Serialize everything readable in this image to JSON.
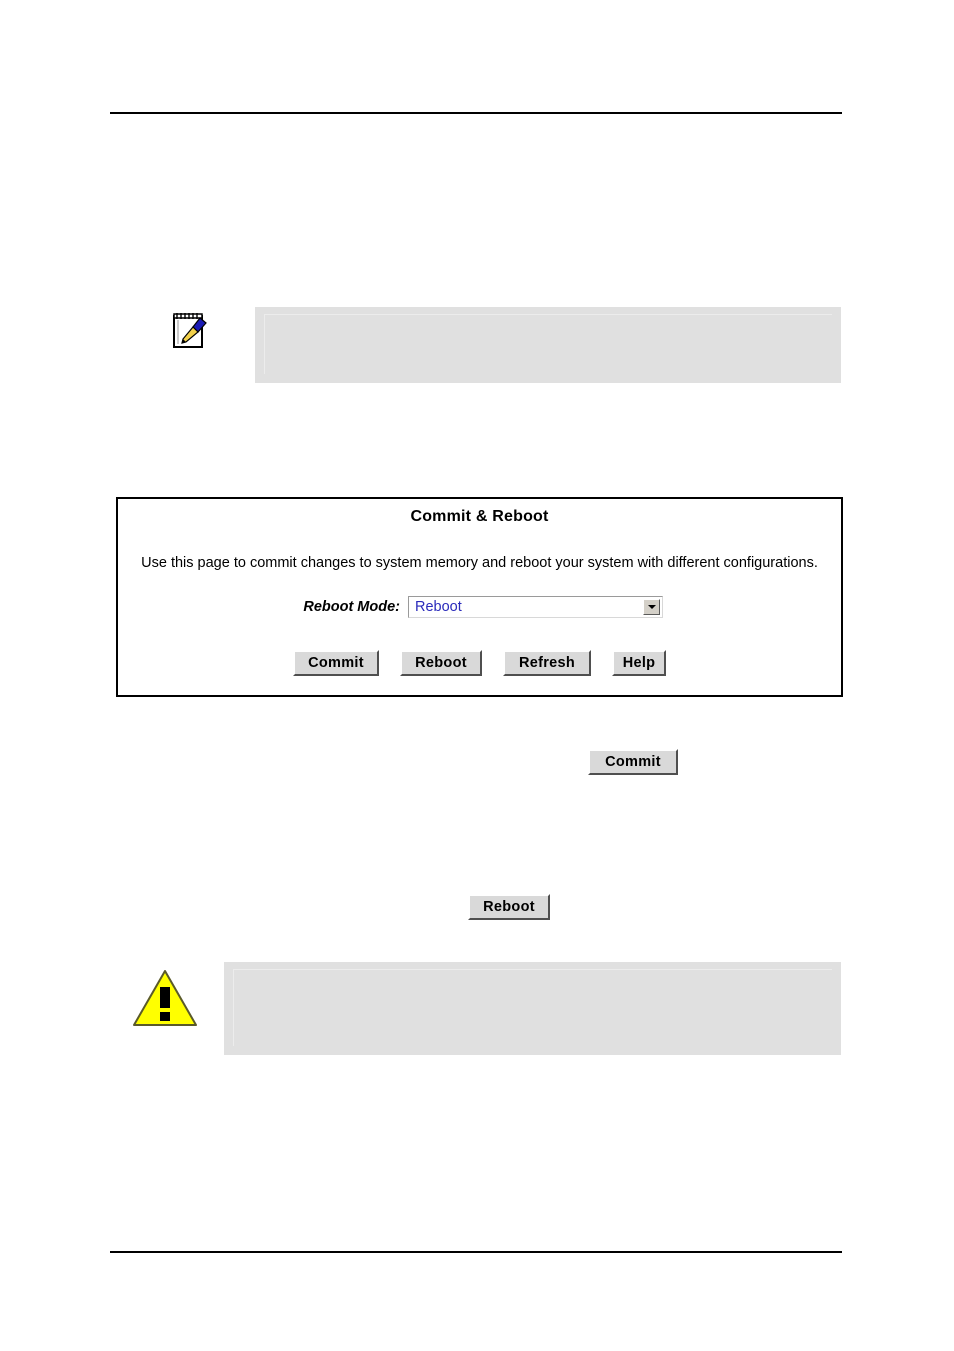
{
  "page": {
    "header_rule": "horizontal-rule",
    "footer_rule": "horizontal-rule"
  },
  "note_callout": {
    "icon": "note-pad-pen-icon",
    "body_text": ""
  },
  "warning_callout": {
    "icon": "warning-triangle-icon",
    "body_text": ""
  },
  "config_panel": {
    "title": "Commit & Reboot",
    "description": "Use this page to commit changes to system memory and reboot your system with different configurations.",
    "reboot_mode": {
      "label": "Reboot Mode:",
      "selected_value": "Reboot",
      "dropdown_icon": "chevron-down-icon",
      "options": [
        "Reboot"
      ]
    },
    "buttons": [
      {
        "id": "commit",
        "label": "Commit"
      },
      {
        "id": "reboot",
        "label": "Reboot"
      },
      {
        "id": "refresh",
        "label": "Refresh"
      },
      {
        "id": "help",
        "label": "Help"
      }
    ]
  },
  "inline_buttons": {
    "commit_label": "Commit",
    "reboot_label": "Reboot"
  },
  "colors": {
    "callout_background": "#e0e0e0",
    "select_value_text": "#2b2bbb",
    "button_face": "#d9d9d9",
    "warning_yellow": "#ffff00"
  }
}
